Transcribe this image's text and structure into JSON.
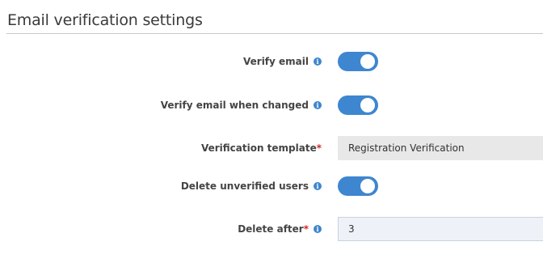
{
  "section": {
    "title": "Email verification settings"
  },
  "settings": {
    "verify_email": {
      "label": "Verify email",
      "enabled": true
    },
    "verify_email_changed": {
      "label": "Verify email when changed",
      "enabled": true
    },
    "verification_template": {
      "label": "Verification template",
      "required_mark": "*",
      "value": "Registration Verification"
    },
    "delete_unverified": {
      "label": "Delete unverified users",
      "enabled": true
    },
    "delete_after": {
      "label": "Delete after",
      "required_mark": "*",
      "value": "3"
    }
  },
  "colors": {
    "accent": "#3e86d0",
    "required": "#d22a2a"
  },
  "icons": {
    "info": "info-circle-icon"
  }
}
